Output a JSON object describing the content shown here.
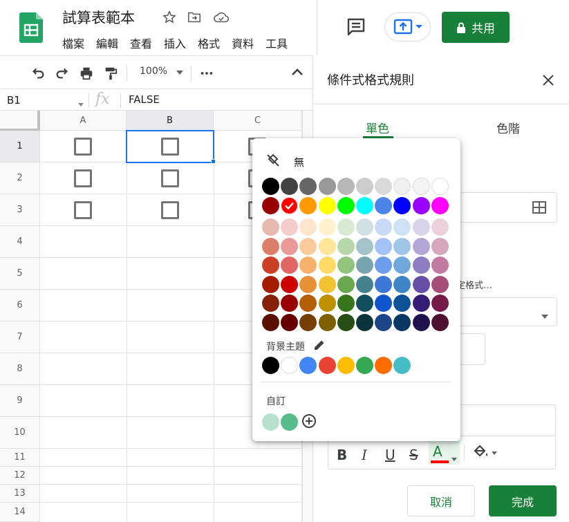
{
  "header": {
    "doc_title": "試算表範本",
    "menu": [
      "檔案",
      "編輯",
      "查看",
      "插入",
      "格式",
      "資料",
      "工具"
    ],
    "share_label": "共用"
  },
  "toolbar": {
    "zoom": "100%"
  },
  "formula_bar": {
    "cell_ref": "B1",
    "fx": "fx",
    "value": "FALSE"
  },
  "grid": {
    "columns": [
      "A",
      "B",
      "C"
    ],
    "rows": [
      "1",
      "2",
      "3",
      "4",
      "5",
      "6",
      "7",
      "8",
      "9",
      "10",
      "11",
      "12",
      "13",
      "14"
    ],
    "selected_cell": "B1"
  },
  "panel": {
    "title": "條件式格式規則",
    "tabs": [
      "單色",
      "色階"
    ],
    "active_tab": "單色",
    "hint_fragment": "定格式…",
    "cancel_label": "取消",
    "done_label": "完成",
    "format_buttons": [
      "B",
      "I",
      "U",
      "S",
      "A"
    ]
  },
  "color_popup": {
    "none_label": "無",
    "theme_label": "背景主題",
    "custom_label": "自訂",
    "selected_color": "#ff0000",
    "palette": [
      [
        "#000000",
        "#434343",
        "#666666",
        "#999999",
        "#b7b7b7",
        "#cccccc",
        "#d9d9d9",
        "#efefef",
        "#f3f3f3",
        "#ffffff"
      ],
      [
        "#980000",
        "#ff0000",
        "#ff9900",
        "#ffff00",
        "#00ff00",
        "#00ffff",
        "#4a86e8",
        "#0000ff",
        "#9900ff",
        "#ff00ff"
      ],
      [
        "#e6b8af",
        "#f4cccc",
        "#fce5cd",
        "#fff2cc",
        "#d9ead3",
        "#d0e0e3",
        "#c9daf8",
        "#cfe2f3",
        "#d9d2e9",
        "#ead1dc"
      ],
      [
        "#dd7e6b",
        "#ea9999",
        "#f9cb9c",
        "#ffe599",
        "#b6d7a8",
        "#a2c4c9",
        "#a4c2f4",
        "#9fc5e8",
        "#b4a7d6",
        "#d5a6bd"
      ],
      [
        "#cc4125",
        "#e06666",
        "#f6b26b",
        "#ffd966",
        "#93c47d",
        "#76a5af",
        "#6d9eeb",
        "#6fa8dc",
        "#8e7cc3",
        "#c27ba0"
      ],
      [
        "#a61c00",
        "#cc0000",
        "#e69138",
        "#f1c232",
        "#6aa84f",
        "#45818e",
        "#3c78d8",
        "#3d85c6",
        "#674ea7",
        "#a64d79"
      ],
      [
        "#85200c",
        "#990000",
        "#b45f06",
        "#bf9000",
        "#38761d",
        "#134f5c",
        "#1155cc",
        "#0b5394",
        "#351c75",
        "#741b47"
      ],
      [
        "#5b0f00",
        "#660000",
        "#783f04",
        "#7f6000",
        "#274e13",
        "#0c343d",
        "#1c4587",
        "#073763",
        "#20124d",
        "#4c1130"
      ]
    ],
    "theme_colors": [
      "#000000",
      "#ffffff",
      "#4285f4",
      "#ea4335",
      "#fbbc04",
      "#34a853",
      "#ff6d01",
      "#46bdc6"
    ],
    "custom_colors": [
      "#b7e1cd",
      "#57bb8a"
    ]
  }
}
